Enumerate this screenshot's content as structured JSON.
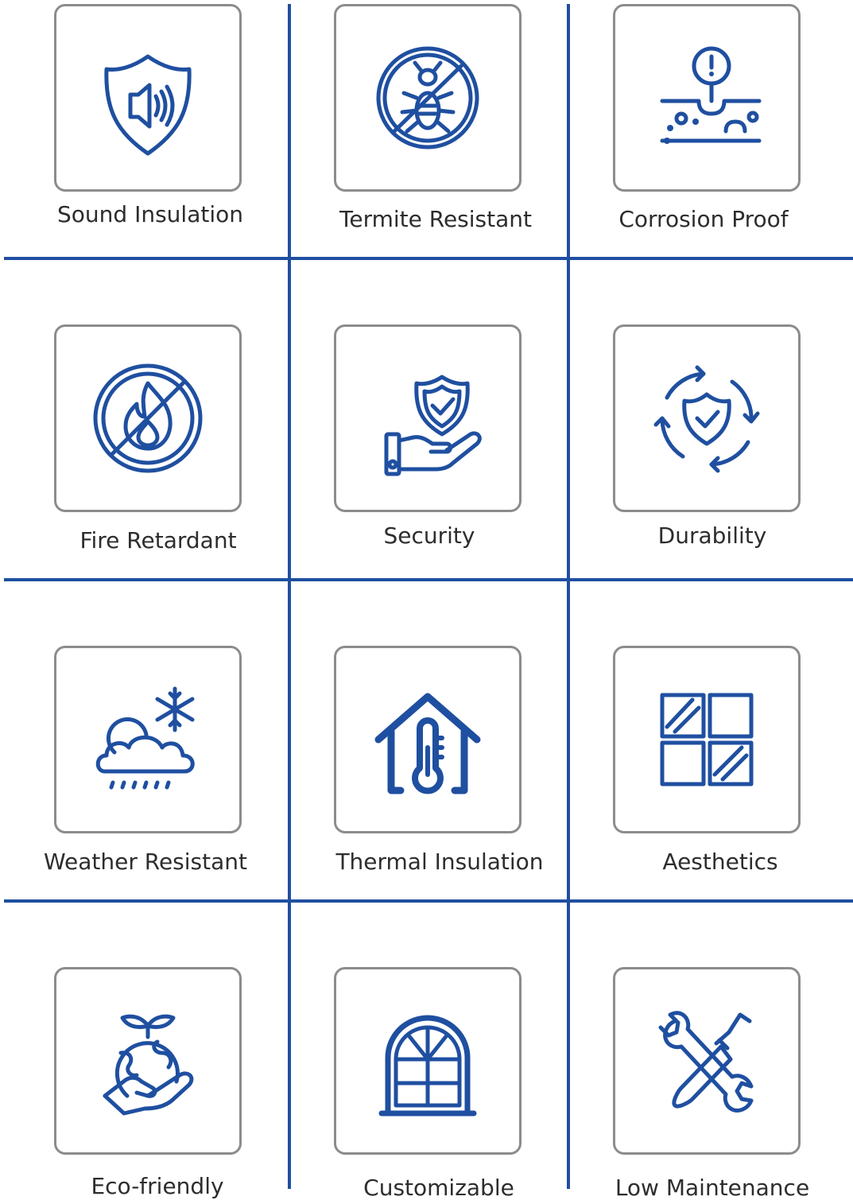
{
  "colors": {
    "accent": "#1f4fa0",
    "card_border": "#8c8c8c",
    "text": "#2d2d2d"
  },
  "features": [
    {
      "label": "Sound Insulation",
      "icon": "sound-shield-icon"
    },
    {
      "label": "Termite Resistant",
      "icon": "no-termite-icon"
    },
    {
      "label": "Corrosion Proof",
      "icon": "corrosion-icon"
    },
    {
      "label": "Fire Retardant",
      "icon": "no-fire-icon"
    },
    {
      "label": "Security",
      "icon": "shield-hand-icon"
    },
    {
      "label": "Durability",
      "icon": "shield-cycle-icon"
    },
    {
      "label": "Weather Resistant",
      "icon": "weather-icon"
    },
    {
      "label": "Thermal Insulation",
      "icon": "house-thermometer-icon"
    },
    {
      "label": "Aesthetics",
      "icon": "window-panes-icon"
    },
    {
      "label": "Eco-friendly",
      "icon": "earth-hand-icon"
    },
    {
      "label": "Customizable",
      "icon": "arched-window-icon"
    },
    {
      "label": "Low Maintenance",
      "icon": "tools-icon"
    }
  ]
}
